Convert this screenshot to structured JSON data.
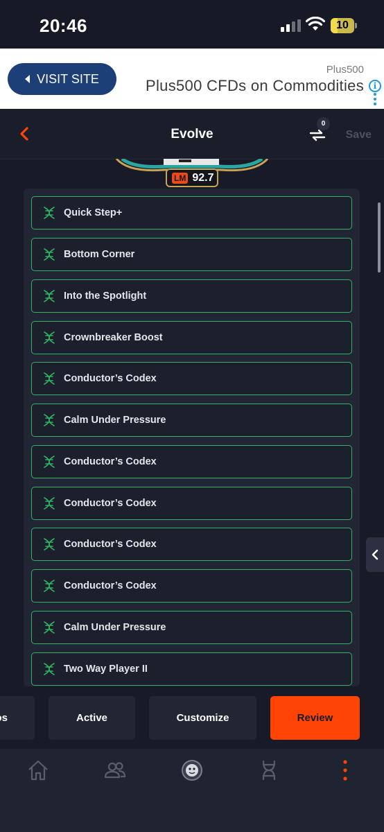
{
  "status_bar": {
    "time": "20:46",
    "battery": "10"
  },
  "ad": {
    "button_label": "VISIT SITE",
    "brand": "Plus500",
    "headline": "Plus500 CFDs on Commodities",
    "info_glyph": "i"
  },
  "header": {
    "title": "Evolve",
    "compare_count": "0",
    "save_label": "Save"
  },
  "player": {
    "position": "LM",
    "rating": "92.7"
  },
  "evolutions": [
    {
      "label": "Quick Step+"
    },
    {
      "label": "Bottom Corner"
    },
    {
      "label": "Into the Spotlight"
    },
    {
      "label": "Crownbreaker Boost"
    },
    {
      "label": "Conductor’s Codex"
    },
    {
      "label": "Calm Under Pressure"
    },
    {
      "label": "Conductor’s Codex"
    },
    {
      "label": "Conductor’s Codex"
    },
    {
      "label": "Conductor’s Codex"
    },
    {
      "label": "Conductor’s Codex"
    },
    {
      "label": "Calm Under Pressure"
    },
    {
      "label": "Two Way Player II"
    }
  ],
  "actions": {
    "partial_label": "os",
    "active": "Active",
    "customize": "Customize",
    "review": "Review"
  },
  "colors": {
    "accent": "#ff4405",
    "item_border": "#2fb464",
    "background": "#181b27"
  },
  "icons": {
    "nav": [
      "home-icon",
      "friends-icon",
      "club-icon",
      "evolutions-icon",
      "more-icon"
    ]
  }
}
